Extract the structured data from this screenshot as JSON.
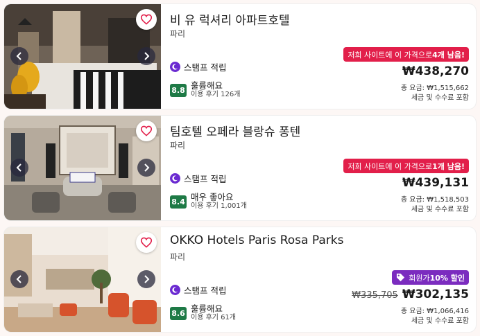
{
  "hotels": [
    {
      "name": "비 유 럭셔리 아파트호텔",
      "city": "파리",
      "stamp_label": "스탬프 적립",
      "score": "8.8",
      "rating_label": "훌륭해요",
      "reviews": "이용 후기 126개",
      "badge_text": "저희 사이트에 이 가격으로 ",
      "badge_bold": "4개 남음!",
      "original_price": "",
      "price": "₩438,270",
      "total": "총 요금: ₩1,515,662",
      "fees": "세금 및 수수료 포함"
    },
    {
      "name": "팀호텔 오페라 블랑슈 퐁텐",
      "city": "파리",
      "stamp_label": "스탬프 적립",
      "score": "8.4",
      "rating_label": "매우 좋아요",
      "reviews": "이용 후기 1,001개",
      "badge_text": "저희 사이트에 이 가격으로 ",
      "badge_bold": "1개 남음!",
      "original_price": "",
      "price": "₩439,131",
      "total": "총 요금: ₩1,518,503",
      "fees": "세금 및 수수료 포함"
    },
    {
      "name": "OKKO Hotels Paris Rosa Parks",
      "city": "파리",
      "stamp_label": "스탬프 적립",
      "score": "8.6",
      "rating_label": "훌륭해요",
      "reviews": "이용 후기 61개",
      "badge_text": "회원가 ",
      "badge_bold": "10% 할인",
      "original_price": "₩335,705",
      "price": "₩302,135",
      "total": "총 요금: ₩1,066,416",
      "fees": "세금 및 수수료 포함"
    }
  ],
  "icons": {
    "favorite": "heart-outline-icon",
    "prev": "chevron-left-icon",
    "next": "chevron-right-icon",
    "stamp": "stamp-moon-icon",
    "tag": "tag-icon"
  },
  "colors": {
    "heart": "#e21f4a",
    "score_bg": "#1e7a46",
    "urgency_badge": "#e21f4a",
    "member_badge": "#7b2cbf",
    "stamp_icon": "#6b2bd1"
  }
}
